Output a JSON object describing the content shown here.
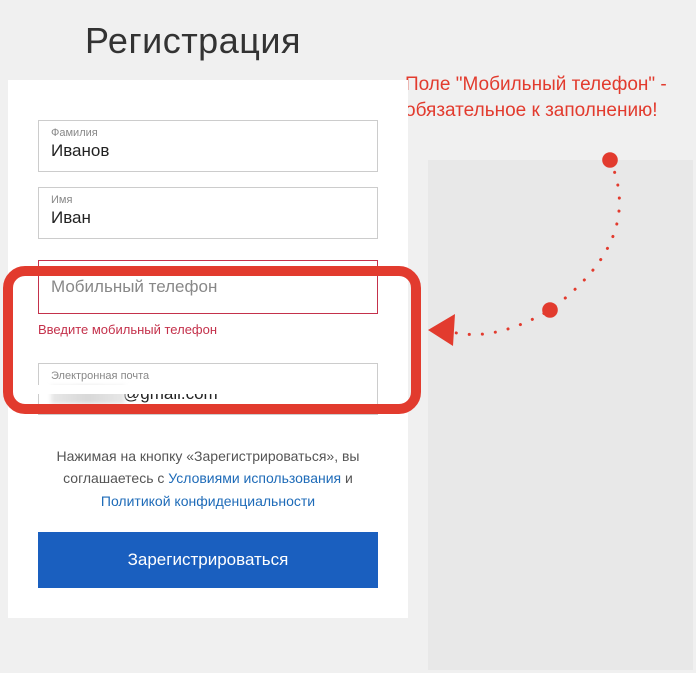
{
  "title": "Регистрация",
  "annotation": "Поле \"Мобильный телефон\" - обязательное к заполнению!",
  "fields": {
    "surname": {
      "label": "Фамилия",
      "value": "Иванов"
    },
    "name": {
      "label": "Имя",
      "value": "Иван"
    },
    "phone": {
      "placeholder": "Мобильный телефон",
      "error": "Введите мобильный телефон"
    },
    "email": {
      "label": "Электронная почта",
      "suffix": "@gmail.com"
    }
  },
  "terms": {
    "prefix": "Нажимая на кнопку «Зарегистрироваться», вы соглашаетесь с ",
    "link1": "Условиями использования",
    "middle": " и ",
    "link2": "Политикой конфиденциальности"
  },
  "submit": "Зарегистрироваться"
}
